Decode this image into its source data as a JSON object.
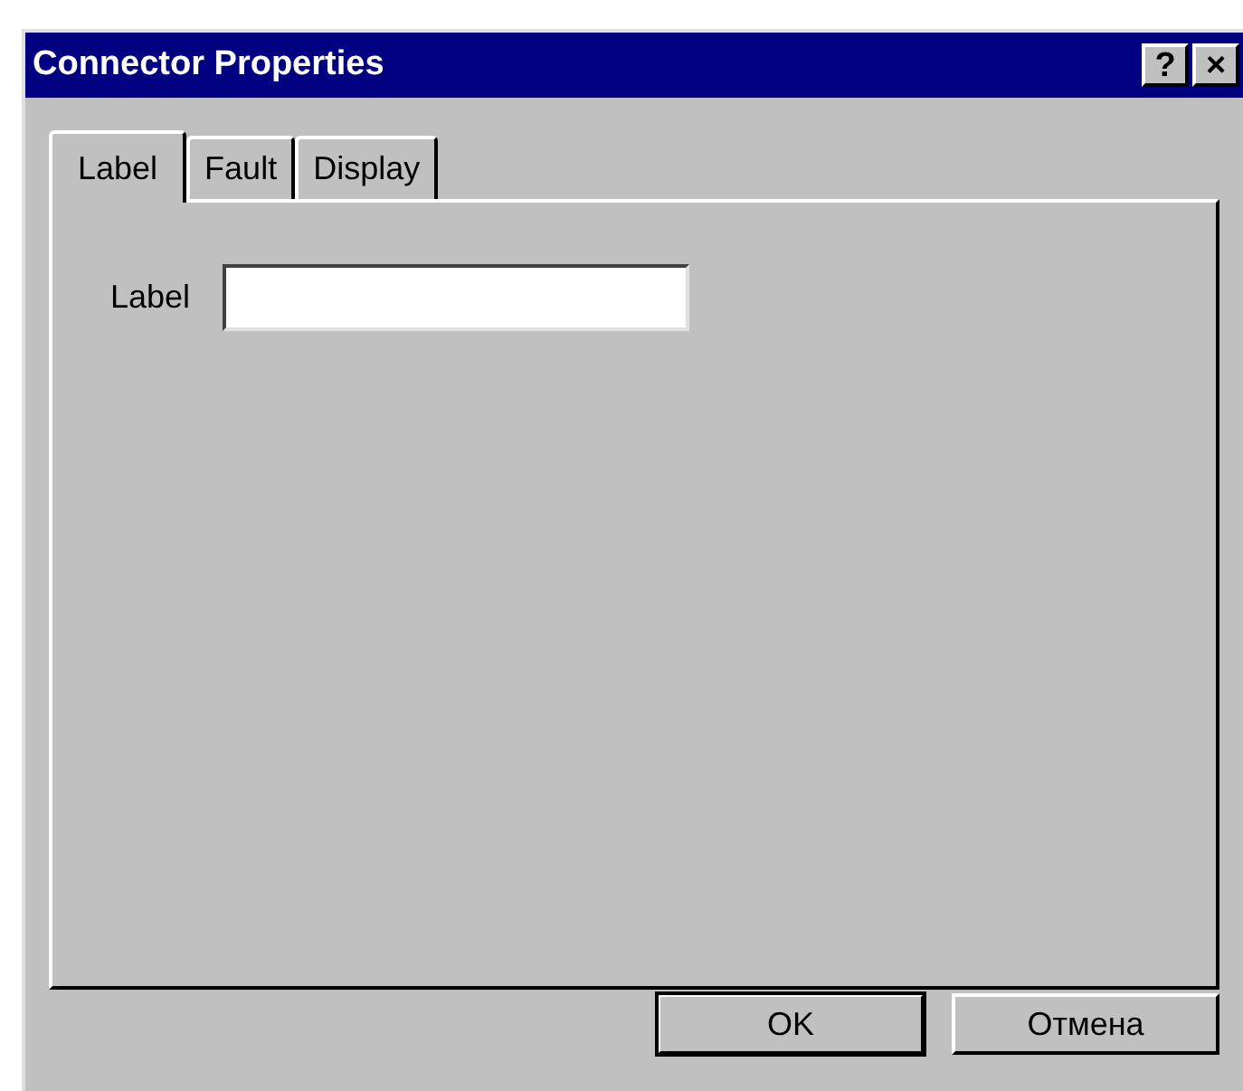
{
  "window": {
    "title": "Connector Properties",
    "title_buttons": [
      "?",
      "×"
    ]
  },
  "tabs": [
    {
      "label": "Label",
      "selected": true
    },
    {
      "label": "Fault",
      "selected": false
    },
    {
      "label": "Display",
      "selected": false
    }
  ],
  "fields": [
    {
      "label": "Label"
    }
  ],
  "buttons": [
    {
      "label": "OK",
      "default": true
    },
    {
      "label": "Отмена",
      "default": false
    }
  ]
}
